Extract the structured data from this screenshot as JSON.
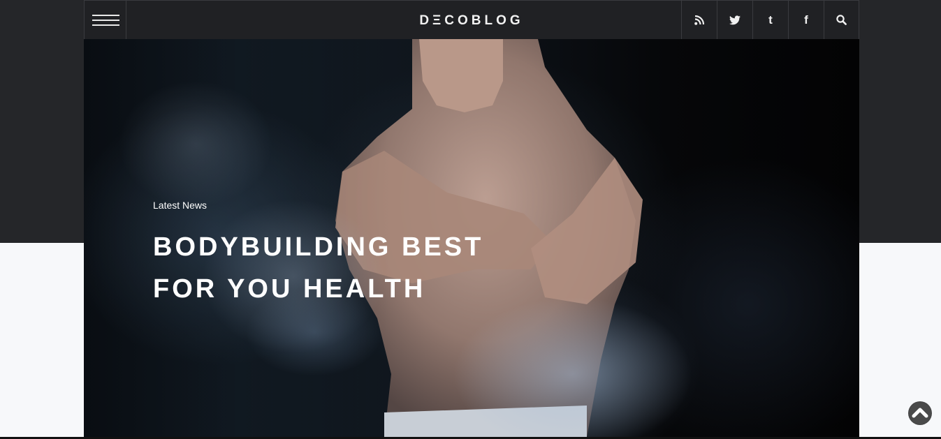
{
  "header": {
    "logo_left": "DΞCO",
    "logo_right": "BLOG",
    "icons": [
      {
        "name": "rss-icon",
        "glyph": "rss"
      },
      {
        "name": "twitter-icon",
        "glyph": "twitter"
      },
      {
        "name": "tumblr-icon",
        "glyph": "t"
      },
      {
        "name": "facebook-icon",
        "glyph": "f"
      },
      {
        "name": "search-icon",
        "glyph": "search"
      }
    ]
  },
  "hero": {
    "category": "Latest News",
    "title_line1": "BODYBUILDING BEST",
    "title_line2": "FOR YOU HEALTH"
  },
  "colors": {
    "header_bg": "#202124",
    "band_bg": "#252629",
    "page_bg": "#f7f8fa",
    "scroll_top_bg": "#444444"
  }
}
